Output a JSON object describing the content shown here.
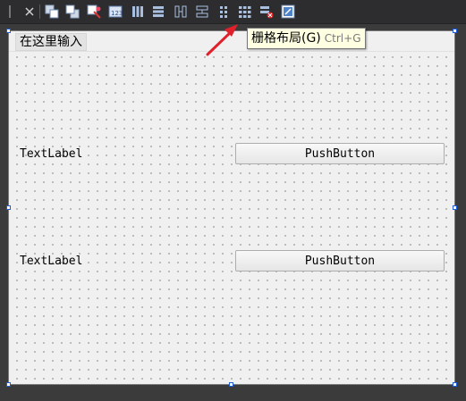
{
  "menubar": {
    "type_here": "在这里输入"
  },
  "tooltip": {
    "text": "栅格布局(G)",
    "shortcut": "Ctrl+G"
  },
  "form": {
    "row1": {
      "label": "TextLabel",
      "button": "PushButton"
    },
    "row2": {
      "label": "TextLabel",
      "button": "PushButton"
    }
  },
  "toolbar": {
    "items": [
      "send-to-back-icon",
      "bring-to-front-icon",
      "edit-signals-slots-icon",
      "edit-buddies-icon",
      "edit-tab-order-icon",
      "layout-horizontal-icon",
      "layout-vertical-icon",
      "layout-horizontal-splitter-icon",
      "layout-vertical-splitter-icon",
      "layout-form-icon",
      "layout-grid-icon",
      "break-layout-icon",
      "adjust-size-icon"
    ]
  },
  "colors": {
    "accent": "#1e5bd6",
    "arrow": "#e0202a",
    "tooltip_bg": "#ffffe1"
  }
}
